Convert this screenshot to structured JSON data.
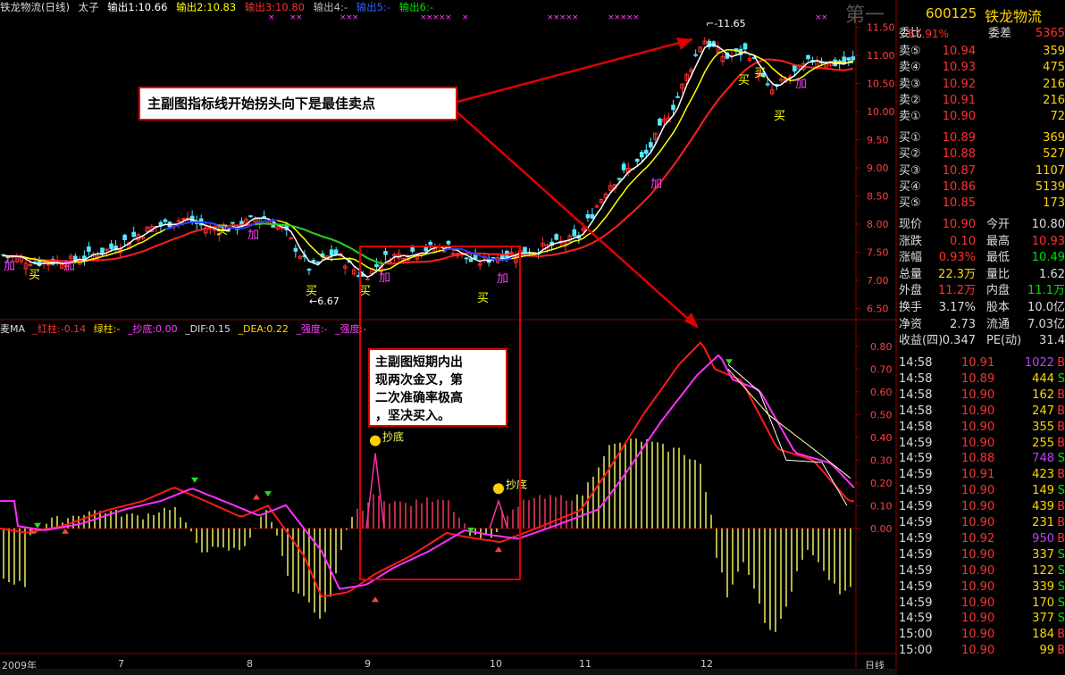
{
  "title_bar": {
    "stock_name": "铁龙物流(日线)",
    "indicator": "太子",
    "out1": "输出1:10.66",
    "out2": "输出2:10.83",
    "out3": "输出3:10.80",
    "out4": "输出4:-",
    "out5": "输出5:-",
    "out6": "输出6:-"
  },
  "sub_bar": {
    "name": "麦MA",
    "red": "_红柱:-0.14",
    "green": "绿柱:-",
    "bottom": "_抄底:0.00",
    "dif": "_DIF:0.15",
    "dea": "_DEA:0.22",
    "strength1": "_强度:-",
    "strength2": "_强度:-"
  },
  "annotations": {
    "sell": "主副图指标线开始拐头向下是最佳卖点",
    "buy": [
      "主副图短期内出",
      "现两次金叉，第",
      "二次准确率极高",
      "，坚决买入。"
    ]
  },
  "chart_labels": {
    "high": "11.65",
    "low": "6.67",
    "buy": "买",
    "add": "加",
    "bottom": "抄底",
    "watermark": "第一"
  },
  "price_axis": [
    "11.50",
    "11.00",
    "10.50",
    "10.00",
    "9.50",
    "9.00",
    "8.50",
    "8.00",
    "7.50",
    "7.00",
    "6.50"
  ],
  "sub_axis": [
    "0.80",
    "0.70",
    "0.60",
    "0.50",
    "0.40",
    "0.30",
    "0.20",
    "0.10",
    "0.00"
  ],
  "x_axis": {
    "year": "2009年",
    "months": [
      "7",
      "8",
      "9",
      "10",
      "11",
      "12"
    ],
    "period": "日线"
  },
  "quote": {
    "code": "600125",
    "name": "铁龙物流",
    "wb_label": "委比",
    "wb_value": "67.91%",
    "wc_label": "委差",
    "wc_value": "5365",
    "sells": [
      {
        "label": "卖⑤",
        "price": "10.94",
        "vol": "359"
      },
      {
        "label": "卖④",
        "price": "10.93",
        "vol": "475"
      },
      {
        "label": "卖③",
        "price": "10.92",
        "vol": "216"
      },
      {
        "label": "卖②",
        "price": "10.91",
        "vol": "216"
      },
      {
        "label": "卖①",
        "price": "10.90",
        "vol": "72"
      }
    ],
    "buys": [
      {
        "label": "买①",
        "price": "10.89",
        "vol": "369"
      },
      {
        "label": "买②",
        "price": "10.88",
        "vol": "527"
      },
      {
        "label": "买③",
        "price": "10.87",
        "vol": "1107"
      },
      {
        "label": "买④",
        "price": "10.86",
        "vol": "5139"
      },
      {
        "label": "买⑤",
        "price": "10.85",
        "vol": "173"
      }
    ],
    "stats": [
      {
        "l1": "现价",
        "v1": "10.90",
        "c1": "red",
        "l2": "今开",
        "v2": "10.80",
        "c2": "white"
      },
      {
        "l1": "涨跌",
        "v1": "0.10",
        "c1": "red",
        "l2": "最高",
        "v2": "10.93",
        "c2": "red"
      },
      {
        "l1": "涨幅",
        "v1": "0.93%",
        "c1": "red",
        "l2": "最低",
        "v2": "10.49",
        "c2": "green"
      },
      {
        "l1": "总量",
        "v1": "22.3万",
        "c1": "yel",
        "l2": "量比",
        "v2": "1.62",
        "c2": "white"
      },
      {
        "l1": "外盘",
        "v1": "11.2万",
        "c1": "red",
        "l2": "内盘",
        "v2": "11.1万",
        "c2": "green"
      },
      {
        "l1": "换手",
        "v1": "3.17%",
        "c1": "white",
        "l2": "股本",
        "v2": "10.0亿",
        "c2": "white"
      },
      {
        "l1": "净资",
        "v1": "2.73",
        "c1": "white",
        "l2": "流通",
        "v2": "7.03亿",
        "c2": "white"
      },
      {
        "l1": "收益(四)",
        "v1": "0.347",
        "c1": "white",
        "l2": "PE(动)",
        "v2": "31.4",
        "c2": "white"
      }
    ],
    "ticks": [
      {
        "t": "14:58",
        "p": "10.91",
        "pc": "red",
        "q": "1022",
        "qc": "#c040ff",
        "s": "B"
      },
      {
        "t": "14:58",
        "p": "10.89",
        "pc": "red",
        "q": "444",
        "qc": "yel",
        "s": "S"
      },
      {
        "t": "14:58",
        "p": "10.90",
        "pc": "red",
        "q": "162",
        "qc": "yel",
        "s": "B"
      },
      {
        "t": "14:58",
        "p": "10.90",
        "pc": "red",
        "q": "247",
        "qc": "yel",
        "s": "B"
      },
      {
        "t": "14:58",
        "p": "10.90",
        "pc": "red",
        "q": "355",
        "qc": "yel",
        "s": "B"
      },
      {
        "t": "14:59",
        "p": "10.90",
        "pc": "red",
        "q": "255",
        "qc": "yel",
        "s": "B"
      },
      {
        "t": "14:59",
        "p": "10.88",
        "pc": "red",
        "q": "748",
        "qc": "#c040ff",
        "s": "S"
      },
      {
        "t": "14:59",
        "p": "10.91",
        "pc": "red",
        "q": "423",
        "qc": "yel",
        "s": "B"
      },
      {
        "t": "14:59",
        "p": "10.90",
        "pc": "red",
        "q": "149",
        "qc": "yel",
        "s": "S"
      },
      {
        "t": "14:59",
        "p": "10.90",
        "pc": "red",
        "q": "439",
        "qc": "yel",
        "s": "B"
      },
      {
        "t": "14:59",
        "p": "10.90",
        "pc": "red",
        "q": "231",
        "qc": "yel",
        "s": "B"
      },
      {
        "t": "14:59",
        "p": "10.92",
        "pc": "red",
        "q": "950",
        "qc": "#c040ff",
        "s": "B"
      },
      {
        "t": "14:59",
        "p": "10.90",
        "pc": "red",
        "q": "337",
        "qc": "yel",
        "s": "S"
      },
      {
        "t": "14:59",
        "p": "10.90",
        "pc": "red",
        "q": "122",
        "qc": "yel",
        "s": "S"
      },
      {
        "t": "14:59",
        "p": "10.90",
        "pc": "red",
        "q": "339",
        "qc": "yel",
        "s": "S"
      },
      {
        "t": "14:59",
        "p": "10.90",
        "pc": "red",
        "q": "170",
        "qc": "yel",
        "s": "S"
      },
      {
        "t": "14:59",
        "p": "10.90",
        "pc": "red",
        "q": "377",
        "qc": "yel",
        "s": "S"
      },
      {
        "t": "15:00",
        "p": "10.90",
        "pc": "red",
        "q": "184",
        "qc": "yel",
        "s": "B"
      },
      {
        "t": "15:00",
        "p": "10.90",
        "pc": "red",
        "q": "99",
        "qc": "yel",
        "s": "B"
      }
    ]
  },
  "colors": {
    "bg": "#000000",
    "up": "#ff3030",
    "down": "#55e8ff",
    "grid": "#8b0000",
    "ma_white": "#ffffff",
    "ma_yellow": "#ffff00",
    "ma_red": "#ff2020",
    "annot": "#e00000"
  }
}
